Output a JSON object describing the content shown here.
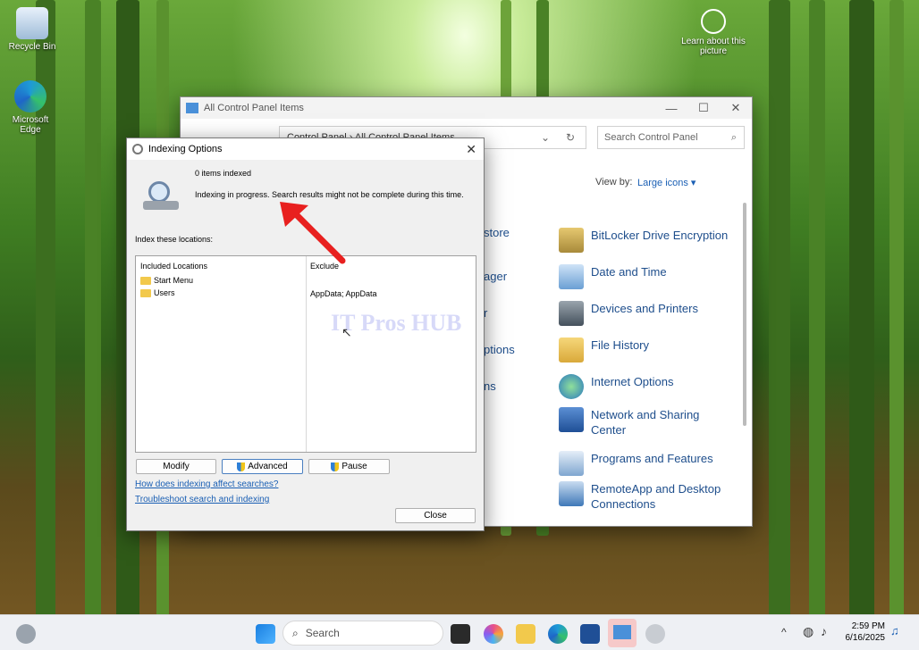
{
  "desktop": {
    "recycle_bin_label": "Recycle Bin",
    "edge_label": "Microsoft Edge",
    "learn_label": "Learn about this picture",
    "watermark": "IT Pros HUB"
  },
  "control_panel": {
    "title": "All Control Panel Items",
    "breadcrumb": "Control Panel  ›  All Control Panel Items",
    "search_placeholder": "Search Control Panel",
    "view_by_label": "View by:",
    "view_by_value": "Large icons ▾",
    "partial_left_items": [
      "store",
      "ager",
      "r",
      "ptions",
      "ns"
    ],
    "items": [
      {
        "label": "BitLocker Drive Encryption",
        "icon": "bitlocker-icon"
      },
      {
        "label": "Date and Time",
        "icon": "date-time-icon"
      },
      {
        "label": "Devices and Printers",
        "icon": "printer-icon"
      },
      {
        "label": "File History",
        "icon": "file-history-icon"
      },
      {
        "label": "Internet Options",
        "icon": "internet-options-icon"
      },
      {
        "label": "Network and Sharing Center",
        "icon": "network-icon"
      },
      {
        "label": "Programs and Features",
        "icon": "programs-icon"
      },
      {
        "label": "RemoteApp and Desktop Connections",
        "icon": "remoteapp-icon"
      }
    ]
  },
  "indexing": {
    "title": "Indexing Options",
    "items_indexed": "0 items indexed",
    "status": "Indexing in progress. Search results might not be complete during this time.",
    "index_locations_label": "Index these locations:",
    "col_included": "Included Locations",
    "col_exclude": "Exclude",
    "rows": [
      {
        "name": "Start Menu",
        "exclude": ""
      },
      {
        "name": "Users",
        "exclude": "AppData; AppData"
      }
    ],
    "modify_label": "Modify",
    "advanced_label": "Advanced",
    "pause_label": "Pause",
    "link_affect": "How does indexing affect searches?",
    "link_troubleshoot": "Troubleshoot search and indexing",
    "close_label": "Close"
  },
  "taskbar": {
    "search_placeholder": "Search",
    "time": "2:59 PM",
    "date": "6/16/2025"
  }
}
